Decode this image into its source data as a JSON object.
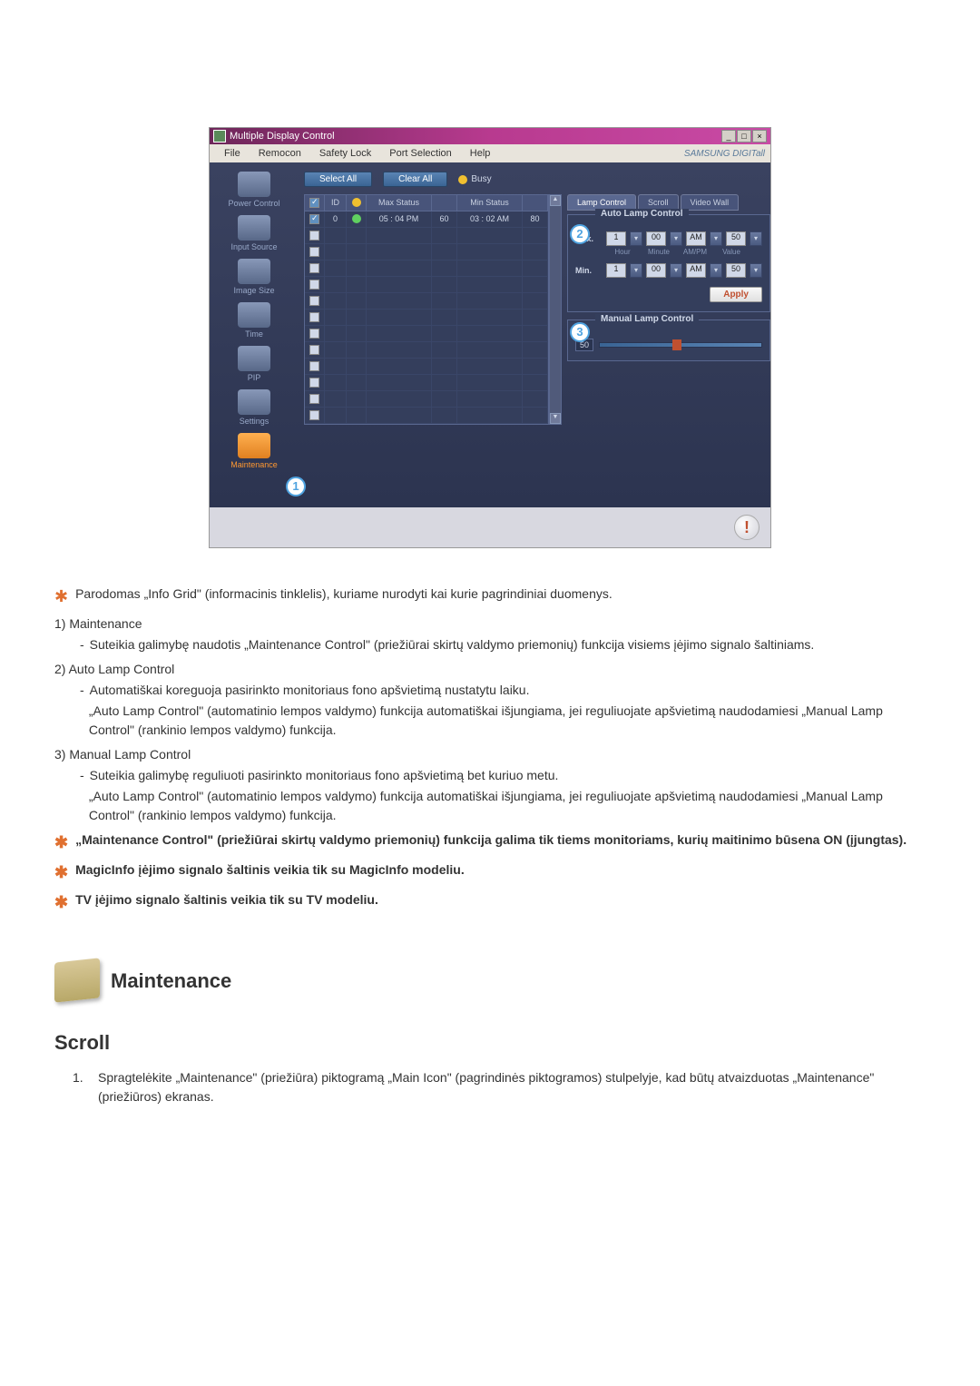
{
  "app": {
    "title": "Multiple Display Control",
    "brand": "SAMSUNG DIGITall"
  },
  "menu": {
    "file": "File",
    "remocon": "Remocon",
    "safety": "Safety Lock",
    "port": "Port Selection",
    "help": "Help"
  },
  "sidebar": {
    "power": "Power Control",
    "input": "Input Source",
    "image": "Image Size",
    "time": "Time",
    "pip": "PIP",
    "settings": "Settings",
    "maintenance": "Maintenance"
  },
  "toolbar": {
    "select_all": "Select All",
    "clear_all": "Clear All",
    "busy": "Busy"
  },
  "grid": {
    "id_h": "ID",
    "max_h": "Max Status",
    "min_h": "Min Status",
    "row0": {
      "id": "0",
      "max_time": "05 : 04 PM",
      "max_val": "60",
      "min_time": "03 : 02 AM",
      "min_val": "80"
    }
  },
  "tabs": {
    "lamp": "Lamp Control",
    "scroll": "Scroll",
    "videowall": "Video Wall"
  },
  "auto_lamp": {
    "title": "Auto Lamp Control",
    "max": "Max.",
    "min": "Min.",
    "hour1": "1",
    "minute": "00",
    "ampm": "AM",
    "value": "50",
    "sub_hour": "Hour",
    "sub_minute": "Minute",
    "sub_ampm": "AM/PM",
    "sub_value": "Value",
    "apply": "Apply"
  },
  "manual_lamp": {
    "title": "Manual Lamp Control",
    "value": "50"
  },
  "callouts": {
    "c1": "1",
    "c2": "2",
    "c3": "3"
  },
  "text": {
    "intro": "Parodomas „Info Grid\" (informacinis tinklelis), kuriame nurodyti kai kurie pagrindiniai duomenys.",
    "item1_h": "1)  Maintenance",
    "item1_d": "Suteikia galimybę naudotis „Maintenance Control\" (priežiūrai skirtų valdymo priemonių) funkcija visiems įėjimo signalo šaltiniams.",
    "item2_h": "2)  Auto Lamp Control",
    "item2_d1": "Automatiškai koreguoja pasirinkto monitoriaus fono apšvietimą nustatytu laiku.",
    "item2_d2": "„Auto Lamp Control\" (automatinio lempos valdymo) funkcija automatiškai išjungiama, jei reguliuojate apšvietimą naudodamiesi „Manual Lamp Control\" (rankinio lempos valdymo) funkcija.",
    "item3_h": "3)  Manual Lamp Control",
    "item3_d1": "Suteikia galimybę reguliuoti pasirinkto monitoriaus fono apšvietimą bet kuriuo metu.",
    "item3_d2": "„Auto Lamp Control\" (automatinio lempos valdymo) funkcija automatiškai išjungiama, jei reguliuojate apšvietimą naudodamiesi „Manual Lamp Control\" (rankinio lempos valdymo) funkcija.",
    "note1": "„Maintenance Control\" (priežiūrai skirtų valdymo priemonių) funkcija galima tik tiems monitoriams, kurių maitinimo būsena ON (įjungtas).",
    "note2": "MagicInfo įėjimo signalo šaltinis veikia tik su MagicInfo modeliu.",
    "note3": "TV įėjimo signalo šaltinis veikia tik su TV modeliu.",
    "section": "Maintenance",
    "subsection": "Scroll",
    "ol1": "Spragtelėkite „Maintenance\" (priežiūra) piktogramą „Main Icon\" (pagrindinės piktogramos) stulpelyje, kad būtų atvaizduotas „Maintenance\" (priežiūros) ekranas."
  }
}
